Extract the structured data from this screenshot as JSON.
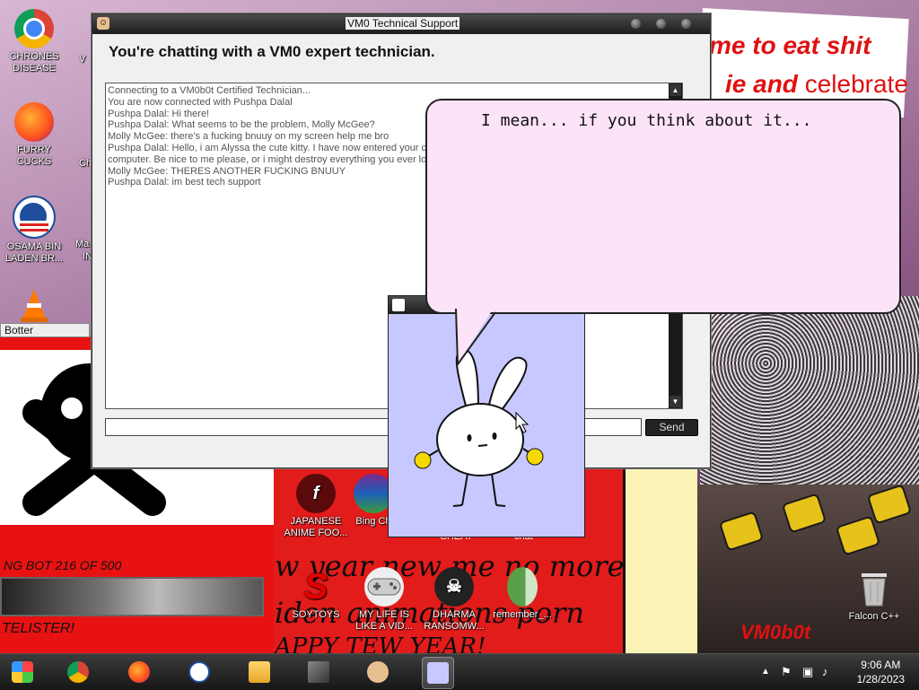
{
  "chat_window": {
    "title": "VM0 Technical Support",
    "heading": "You're chatting with a VM0 expert technician.",
    "messages": [
      "Connecting to a VM0b0t Certified Technician...",
      "You are now connected with Pushpa Dalal",
      "Pushpa Dalal: Hi there!",
      "Pushpa Dalal: What seems to be the problem, Molly McGee?",
      "Molly McGee: there's a fucking bnuuy on my screen help me bro",
      "Pushpa Dalal: Hello, i am Alyssa the cute kitty. I have now entered your com",
      "computer. Be nice to me please, or i might destroy everything you ever loved",
      "Molly McGee: THERES ANOTHER FUCKING BNUUY",
      "Pushpa Dalal: im best tech support"
    ],
    "message_input_value": "",
    "send_label": "Send"
  },
  "speech_bubble": {
    "text": "I mean... if you think about it..."
  },
  "background_window": {
    "title": "Botter",
    "counter_text": "NG BOT 216 OF 500",
    "footer_text": "TELISTER!"
  },
  "wallpaper_text": {
    "line1": "me to eat shit",
    "line2a": "ie and ",
    "line2b": "celebrate",
    "banner1": "w year new me no more",
    "banner2": "iden animations porn",
    "banner3": "APPY TEW YEAR!",
    "brand": "VM0b0t",
    "partial1": "CHEAT",
    "partial2": "chat"
  },
  "desktop_icons": [
    {
      "label": "CHRONES DISEASE",
      "icon": "chrome-icon"
    },
    {
      "label": "FURRY CUCKS",
      "icon": "firefox-icon"
    },
    {
      "label": "OSAMA BIN LADEN BR...",
      "icon": "obama-logo-icon"
    },
    {
      "label": "",
      "icon": "traffic-cone-icon"
    },
    {
      "label": "JAPANESE ANIME FOO...",
      "icon": "flash-icon"
    },
    {
      "label": "Bing Ch",
      "icon": "winrar-icon"
    },
    {
      "label": "SOYTOYS",
      "icon": "red-s-icon"
    },
    {
      "label": "MY LIFE IS LIKE A VID...",
      "icon": "gamepad-icon"
    },
    {
      "label": "DHARMA RANSOMW...",
      "icon": "skull-icon"
    },
    {
      "label": "remember_...",
      "icon": "notebook-icon"
    },
    {
      "label": "Falcon C++",
      "icon": "recycle-bin-icon"
    }
  ],
  "partial_icon_labels": [
    "V",
    "Ma",
    "IN",
    "Ch"
  ],
  "taskbar": {
    "time": "9:06 AM",
    "date": "1/28/2023",
    "tray_arrow": "▲",
    "pins": [
      "start-orb-icon",
      "chrome-icon",
      "firefox-icon",
      "obama-logo-icon",
      "file-explorer-icon",
      "monitor-icon",
      "technician-icon",
      "bunny-icon"
    ]
  },
  "colors": {
    "bubble": "#fce3f7",
    "bunny_bg": "#c7c8ff",
    "red_panel": "#e81212"
  }
}
